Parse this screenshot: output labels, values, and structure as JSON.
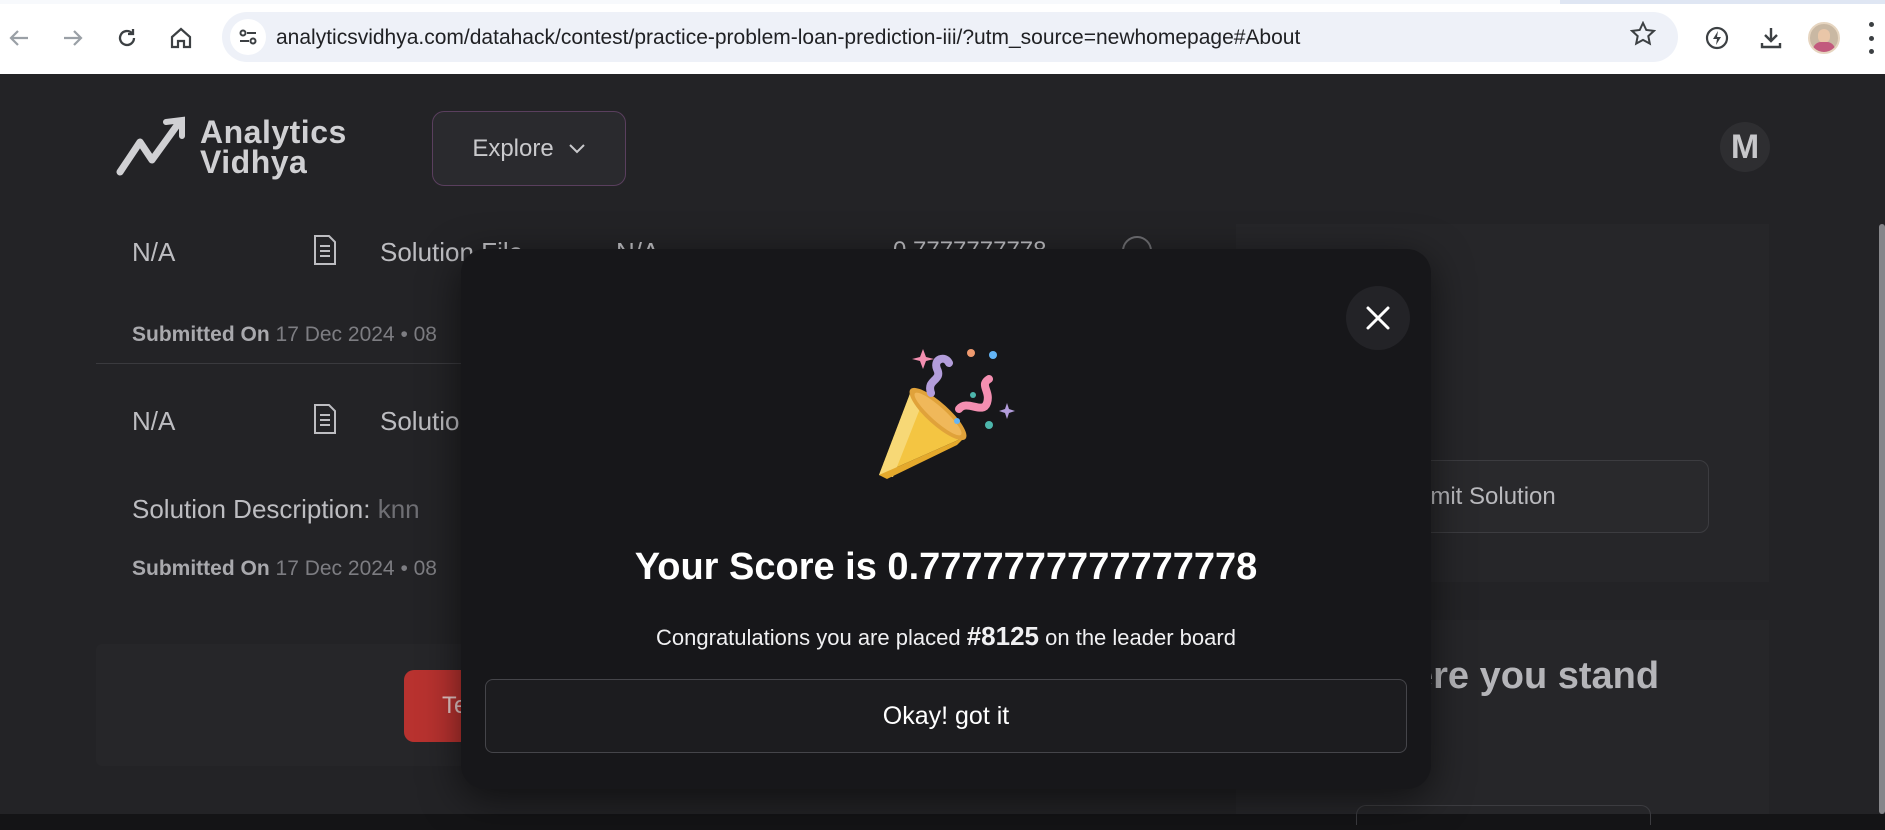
{
  "browser": {
    "url": "analyticsvidhya.com/datahack/contest/practice-problem-loan-prediction-iii/?utm_source=newhomepage#About",
    "icons": [
      "back-arrow-icon",
      "forward-arrow-icon",
      "reload-icon",
      "home-icon",
      "site-settings-icon",
      "bookmark-star-icon",
      "performance-icon",
      "download-icon",
      "profile-avatar",
      "more-menu-icon"
    ]
  },
  "header": {
    "logo_line1": "Analytics",
    "logo_line2": "Vidhya",
    "explore_label": "Explore",
    "avatar_initial": "M"
  },
  "submissions": [
    {
      "score_col": "N/A",
      "file_label": "Solution File",
      "col3": "N/A",
      "score": "0.7777777778",
      "submitted_label": "Submitted On",
      "submitted_value": "17 Dec 2024 • 08"
    },
    {
      "score_col": "N/A",
      "file_label": "Solutio",
      "description_label": "Solution Description:",
      "description_value": "knn",
      "submitted_label": "Submitted On",
      "submitted_value": "17 Dec 2024 • 08"
    }
  ],
  "sidebar": {
    "submit_label": "bmit Solution",
    "stand_heading": "ere you stand"
  },
  "bottom": {
    "red_button_label": "Te"
  },
  "modal": {
    "score_text": "Your Score is 0.7777777777777778",
    "congrats_prefix": "Congratulations you are placed",
    "rank": "#8125",
    "congrats_suffix": "on the leader board",
    "ok_label": "Okay! got it",
    "icon": "party-popper-icon"
  },
  "colors": {
    "page_bg": "#232326",
    "modal_bg": "#17171a",
    "accent_red": "#b8322f"
  }
}
